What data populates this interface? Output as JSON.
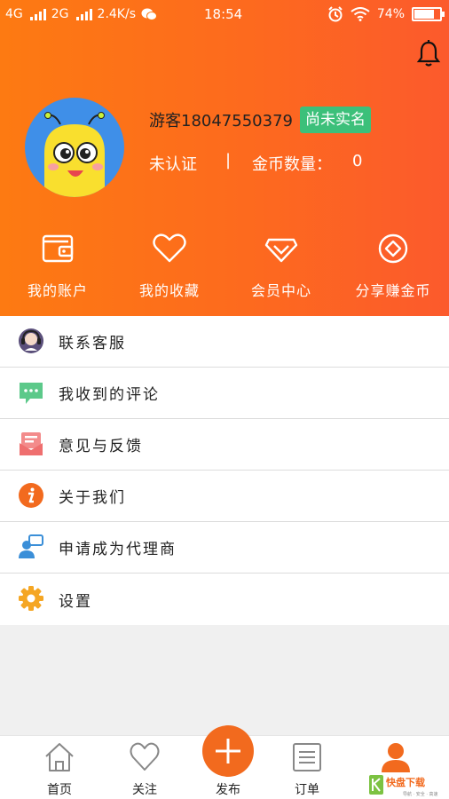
{
  "status_bar": {
    "network1": "4G",
    "network2": "2G",
    "speed": "2.4K/s",
    "time": "18:54",
    "battery": "74%"
  },
  "profile": {
    "username": "游客18047550379",
    "realname_badge": "尚未实名",
    "auth_status": "未认证",
    "separator": "|",
    "coin_label": "金币数量：",
    "coin_value": "0"
  },
  "quick_actions": [
    {
      "label": "我的账户",
      "icon": "wallet-icon"
    },
    {
      "label": "我的收藏",
      "icon": "heart-icon"
    },
    {
      "label": "会员中心",
      "icon": "diamond-icon"
    },
    {
      "label": "分享赚金币",
      "icon": "coin-share-icon"
    }
  ],
  "menu": [
    {
      "label": "联系客服",
      "icon": "customer-service-icon"
    },
    {
      "label": "我收到的评论",
      "icon": "comment-icon"
    },
    {
      "label": "意见与反馈",
      "icon": "feedback-icon"
    },
    {
      "label": "关于我们",
      "icon": "info-icon"
    },
    {
      "label": "申请成为代理商",
      "icon": "agent-icon"
    },
    {
      "label": "设置",
      "icon": "settings-gear-icon"
    }
  ],
  "tabbar": {
    "home": "首页",
    "follow": "关注",
    "publish": "发布",
    "orders": "订单"
  },
  "watermark": {
    "brand": "快盘下载",
    "slogan": "导航 · 安全 · 高速"
  },
  "colors": {
    "header_start": "#fd7a12",
    "header_end": "#fc5a2c",
    "badge_green": "#3cc07a",
    "accent_orange": "#f26a1e"
  }
}
